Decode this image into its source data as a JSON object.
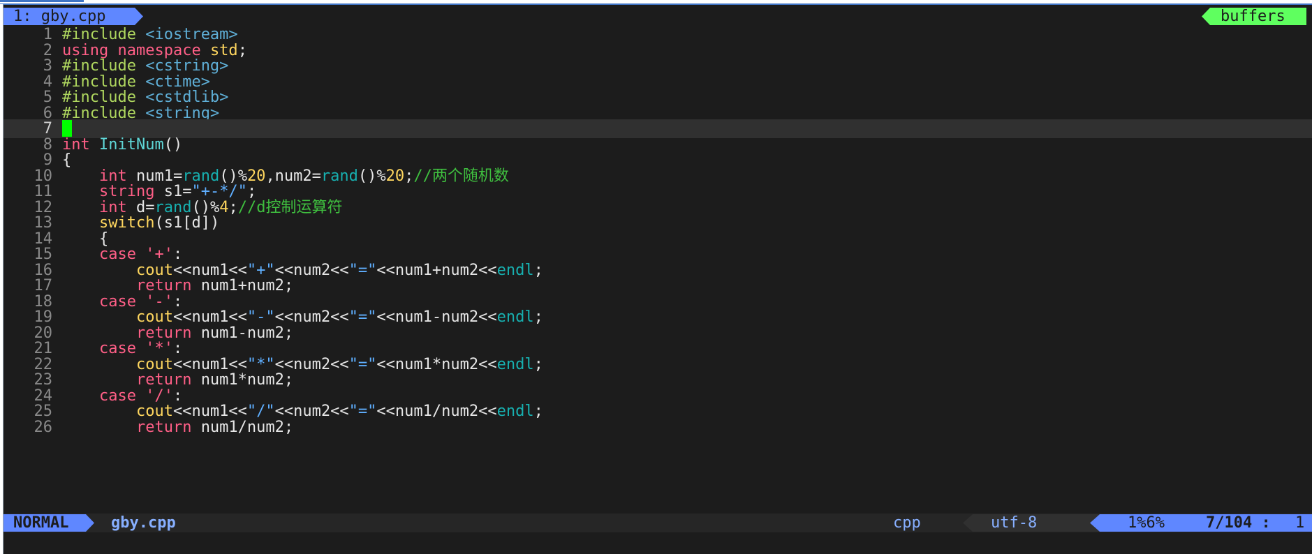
{
  "tabline": {
    "active_tab": "1: gby.cpp",
    "buffers_label": "buffers"
  },
  "editor": {
    "lines": [
      {
        "n": "1",
        "segs": [
          [
            "pp",
            "#include "
          ],
          [
            "inc",
            "<iostream>"
          ]
        ]
      },
      {
        "n": "2",
        "segs": [
          [
            "k",
            "using "
          ],
          [
            "k",
            "namespace "
          ],
          [
            "ns",
            "std"
          ],
          [
            "op",
            ";"
          ]
        ]
      },
      {
        "n": "3",
        "segs": [
          [
            "pp",
            "#include "
          ],
          [
            "inc",
            "<cstring>"
          ]
        ]
      },
      {
        "n": "4",
        "segs": [
          [
            "pp",
            "#include "
          ],
          [
            "inc",
            "<ctime>"
          ]
        ]
      },
      {
        "n": "5",
        "segs": [
          [
            "pp",
            "#include "
          ],
          [
            "inc",
            "<cstdlib>"
          ]
        ]
      },
      {
        "n": "6",
        "segs": [
          [
            "pp",
            "#include "
          ],
          [
            "inc",
            "<string>"
          ]
        ]
      },
      {
        "n": "7",
        "segs": [],
        "current": true
      },
      {
        "n": "8",
        "segs": [
          [
            "k",
            "int "
          ],
          [
            "fn",
            "InitNum"
          ],
          [
            "op",
            "()"
          ]
        ]
      },
      {
        "n": "9",
        "segs": [
          [
            "op",
            "{"
          ]
        ]
      },
      {
        "n": "10",
        "segs": [
          [
            "op",
            "    "
          ],
          [
            "k",
            "int "
          ],
          [
            "op",
            "num1="
          ],
          [
            "lib",
            "rand"
          ],
          [
            "op",
            "()"
          ],
          [
            "op",
            "%"
          ],
          [
            "num",
            "20"
          ],
          [
            "op",
            ",num2="
          ],
          [
            "lib",
            "rand"
          ],
          [
            "op",
            "()"
          ],
          [
            "op",
            "%"
          ],
          [
            "num",
            "20"
          ],
          [
            "op",
            ";"
          ],
          [
            "cmt",
            "//两个随机数"
          ]
        ]
      },
      {
        "n": "11",
        "segs": [
          [
            "op",
            "    "
          ],
          [
            "k",
            "string "
          ],
          [
            "op",
            "s1="
          ],
          [
            "str",
            "\"+-*/\""
          ],
          [
            "op",
            ";"
          ]
        ]
      },
      {
        "n": "12",
        "segs": [
          [
            "op",
            "    "
          ],
          [
            "k",
            "int "
          ],
          [
            "op",
            "d="
          ],
          [
            "lib",
            "rand"
          ],
          [
            "op",
            "()"
          ],
          [
            "op",
            "%"
          ],
          [
            "num",
            "4"
          ],
          [
            "op",
            ";"
          ],
          [
            "cmt",
            "//d控制运算符"
          ]
        ]
      },
      {
        "n": "13",
        "segs": [
          [
            "op",
            "    "
          ],
          [
            "sw",
            "switch"
          ],
          [
            "op",
            "(s1[d])"
          ]
        ]
      },
      {
        "n": "14",
        "segs": [
          [
            "op",
            "    {"
          ]
        ]
      },
      {
        "n": "15",
        "segs": [
          [
            "op",
            "    "
          ],
          [
            "k",
            "case "
          ],
          [
            "k",
            "'+'"
          ],
          [
            "op",
            ":"
          ]
        ]
      },
      {
        "n": "16",
        "segs": [
          [
            "op",
            "        "
          ],
          [
            "ns",
            "cout"
          ],
          [
            "op",
            "<<num1<<"
          ],
          [
            "str",
            "\"+\""
          ],
          [
            "op",
            "<<num2<<"
          ],
          [
            "str",
            "\"=\""
          ],
          [
            "op",
            "<<num1+num2<<"
          ],
          [
            "lib",
            "endl"
          ],
          [
            "op",
            ";"
          ]
        ]
      },
      {
        "n": "17",
        "segs": [
          [
            "op",
            "        "
          ],
          [
            "k",
            "return "
          ],
          [
            "op",
            "num1+num2;"
          ]
        ]
      },
      {
        "n": "18",
        "segs": [
          [
            "op",
            "    "
          ],
          [
            "k",
            "case "
          ],
          [
            "k",
            "'-'"
          ],
          [
            "op",
            ":"
          ]
        ]
      },
      {
        "n": "19",
        "segs": [
          [
            "op",
            "        "
          ],
          [
            "ns",
            "cout"
          ],
          [
            "op",
            "<<num1<<"
          ],
          [
            "str",
            "\"-\""
          ],
          [
            "op",
            "<<num2<<"
          ],
          [
            "str",
            "\"=\""
          ],
          [
            "op",
            "<<num1-num2<<"
          ],
          [
            "lib",
            "endl"
          ],
          [
            "op",
            ";"
          ]
        ]
      },
      {
        "n": "20",
        "segs": [
          [
            "op",
            "        "
          ],
          [
            "k",
            "return "
          ],
          [
            "op",
            "num1-num2;"
          ]
        ]
      },
      {
        "n": "21",
        "segs": [
          [
            "op",
            "    "
          ],
          [
            "k",
            "case "
          ],
          [
            "k",
            "'*'"
          ],
          [
            "op",
            ":"
          ]
        ]
      },
      {
        "n": "22",
        "segs": [
          [
            "op",
            "        "
          ],
          [
            "ns",
            "cout"
          ],
          [
            "op",
            "<<num1<<"
          ],
          [
            "str",
            "\"*\""
          ],
          [
            "op",
            "<<num2<<"
          ],
          [
            "str",
            "\"=\""
          ],
          [
            "op",
            "<<num1*num2<<"
          ],
          [
            "lib",
            "endl"
          ],
          [
            "op",
            ";"
          ]
        ]
      },
      {
        "n": "23",
        "segs": [
          [
            "op",
            "        "
          ],
          [
            "k",
            "return "
          ],
          [
            "op",
            "num1*num2;"
          ]
        ]
      },
      {
        "n": "24",
        "segs": [
          [
            "op",
            "    "
          ],
          [
            "k",
            "case "
          ],
          [
            "k",
            "'/'"
          ],
          [
            "op",
            ":"
          ]
        ]
      },
      {
        "n": "25",
        "segs": [
          [
            "op",
            "        "
          ],
          [
            "ns",
            "cout"
          ],
          [
            "op",
            "<<num1<<"
          ],
          [
            "str",
            "\"/\""
          ],
          [
            "op",
            "<<num2<<"
          ],
          [
            "str",
            "\"=\""
          ],
          [
            "op",
            "<<num1/num2<<"
          ],
          [
            "lib",
            "endl"
          ],
          [
            "op",
            ";"
          ]
        ]
      },
      {
        "n": "26",
        "segs": [
          [
            "op",
            "        "
          ],
          [
            "k",
            "return "
          ],
          [
            "op",
            "num1/num2;"
          ]
        ]
      }
    ]
  },
  "statusline": {
    "mode": "NORMAL",
    "filename": "gby.cpp",
    "filetype": "cpp",
    "encoding": "utf-8",
    "percent": "1%6%",
    "lines": "7/104",
    "separator": ":",
    "column": "1"
  },
  "colors": {
    "tab_active": "#5f87ff",
    "buffers_tab": "#5fff5f",
    "cursor": "#00ff00",
    "background": "#1c1c1c"
  },
  "icons": {
    "cursor": "block-cursor"
  }
}
